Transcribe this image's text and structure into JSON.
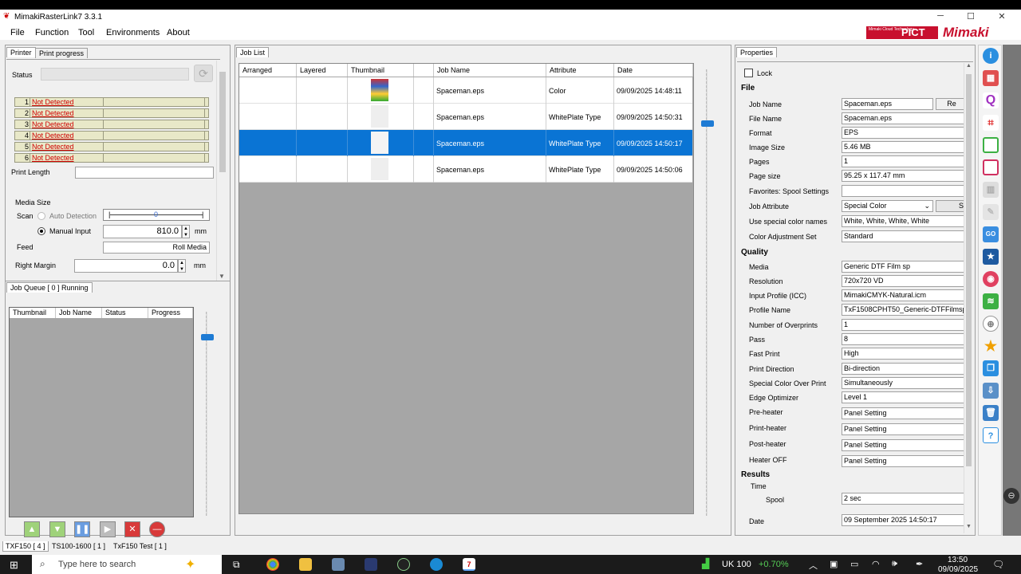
{
  "window": {
    "title": "MimakiRasterLink7 3.3.1",
    "minimize": "─",
    "maximize": "☐",
    "close": "✕"
  },
  "menu": [
    "File",
    "Function",
    "Tool",
    "Environments",
    "About"
  ],
  "logo": {
    "cloud": "Mimaki Cloud Technology",
    "pict": "PICT",
    "brand": "Mimaki"
  },
  "printer_panel": {
    "tabs": [
      "Printer",
      "Print progress"
    ],
    "status_label": "Status",
    "slots": [
      {
        "n": "1",
        "s": "Not Detected"
      },
      {
        "n": "2",
        "s": "Not Detected"
      },
      {
        "n": "3",
        "s": "Not Detected"
      },
      {
        "n": "4",
        "s": "Not Detected"
      },
      {
        "n": "5",
        "s": "Not Detected"
      },
      {
        "n": "6",
        "s": "Not Detected"
      }
    ],
    "print_length_label": "Print Length",
    "media_size_label": "Media Size",
    "scan_label": "Scan",
    "auto_detection": "Auto Detection",
    "manual_input": "Manual Input",
    "scan_slider_value": "0",
    "manual_value": "810.0",
    "unit": "mm",
    "feed_label": "Feed",
    "feed_value": "Roll Media",
    "right_margin_label": "Right Margin",
    "right_margin_value": "0.0",
    "right_margin_unit": "mm"
  },
  "queue_panel": {
    "title": "Job Queue [ 0 ] Running",
    "columns": [
      "Thumbnail",
      "Job Name",
      "Status",
      "Progress"
    ]
  },
  "job_list": {
    "title": "Job List",
    "columns": [
      "Arranged",
      "Layered",
      "Thumbnail",
      "",
      "Job Name",
      "Attribute",
      "Date"
    ],
    "rows": [
      {
        "name": "Spaceman.eps",
        "attribute": "Color",
        "date": "09/09/2025 14:48:11",
        "selected": false
      },
      {
        "name": "Spaceman.eps",
        "attribute": "WhitePlate Type",
        "date": "09/09/2025 14:50:31",
        "selected": false
      },
      {
        "name": "Spaceman.eps",
        "attribute": "WhitePlate Type",
        "date": "09/09/2025 14:50:17",
        "selected": true
      },
      {
        "name": "Spaceman.eps",
        "attribute": "WhitePlate Type",
        "date": "09/09/2025 14:50:06",
        "selected": false
      }
    ]
  },
  "properties": {
    "title": "Properties",
    "lock": "Lock",
    "file_section": "File",
    "file": [
      {
        "k": "Job Name",
        "v": "Spaceman.eps"
      },
      {
        "k": "File Name",
        "v": "Spaceman.eps"
      },
      {
        "k": "Format",
        "v": "EPS"
      },
      {
        "k": "Image Size",
        "v": "5.46 MB"
      },
      {
        "k": "Pages",
        "v": "1"
      },
      {
        "k": "Page size",
        "v": "95.25 x 117.47 mm"
      },
      {
        "k": "Favorites: Spool Settings",
        "v": ""
      },
      {
        "k": "Job Attribute",
        "v": "Special Color"
      },
      {
        "k": "Use special color names",
        "v": "White, White, White, White"
      },
      {
        "k": "Color Adjustment Set",
        "v": "Standard"
      }
    ],
    "rename_btn": "Re",
    "s_btn": "S",
    "quality_section": "Quality",
    "quality": [
      {
        "k": "Media",
        "v": "Generic DTF Film sp"
      },
      {
        "k": "Resolution",
        "v": "720x720 VD"
      },
      {
        "k": "Input Profile (ICC)",
        "v": "MimakiCMYK-Natural.icm"
      },
      {
        "k": "Profile Name",
        "v": "TxF1508CPHT50_Generic-DTFFilmsp_"
      },
      {
        "k": "Number of Overprints",
        "v": "1"
      },
      {
        "k": "Pass",
        "v": "8"
      },
      {
        "k": "Fast Print",
        "v": "High"
      },
      {
        "k": "Print Direction",
        "v": "Bi-direction"
      },
      {
        "k": "Special Color Over Print",
        "v": "Simultaneously"
      },
      {
        "k": "Edge Optimizer",
        "v": "Level 1"
      },
      {
        "k": "Pre-heater",
        "v": "Panel Setting"
      },
      {
        "k": "Print-heater",
        "v": "Panel Setting"
      },
      {
        "k": "Post-heater",
        "v": "Panel Setting"
      },
      {
        "k": "Heater OFF",
        "v": "Panel Setting"
      }
    ],
    "results_section": "Results",
    "time_label": "Time",
    "spool_label": "Spool",
    "spool_value": "2 sec",
    "date_label": "Date",
    "date_value": "09 September 2025 14:50:17"
  },
  "bottom_tabs": [
    "TXF150 [ 4 ]",
    "TS100-1600 [ 1 ]",
    "TxF150 Test [ 1 ]"
  ],
  "taskbar": {
    "search": "Type here to search",
    "stock": "UK 100",
    "stock_change": "+0.70%",
    "time": "13:50",
    "date": "09/09/2025"
  },
  "colors": {
    "selected": "#0a74d4",
    "brand": "#c8102e",
    "error": "#d00000"
  }
}
